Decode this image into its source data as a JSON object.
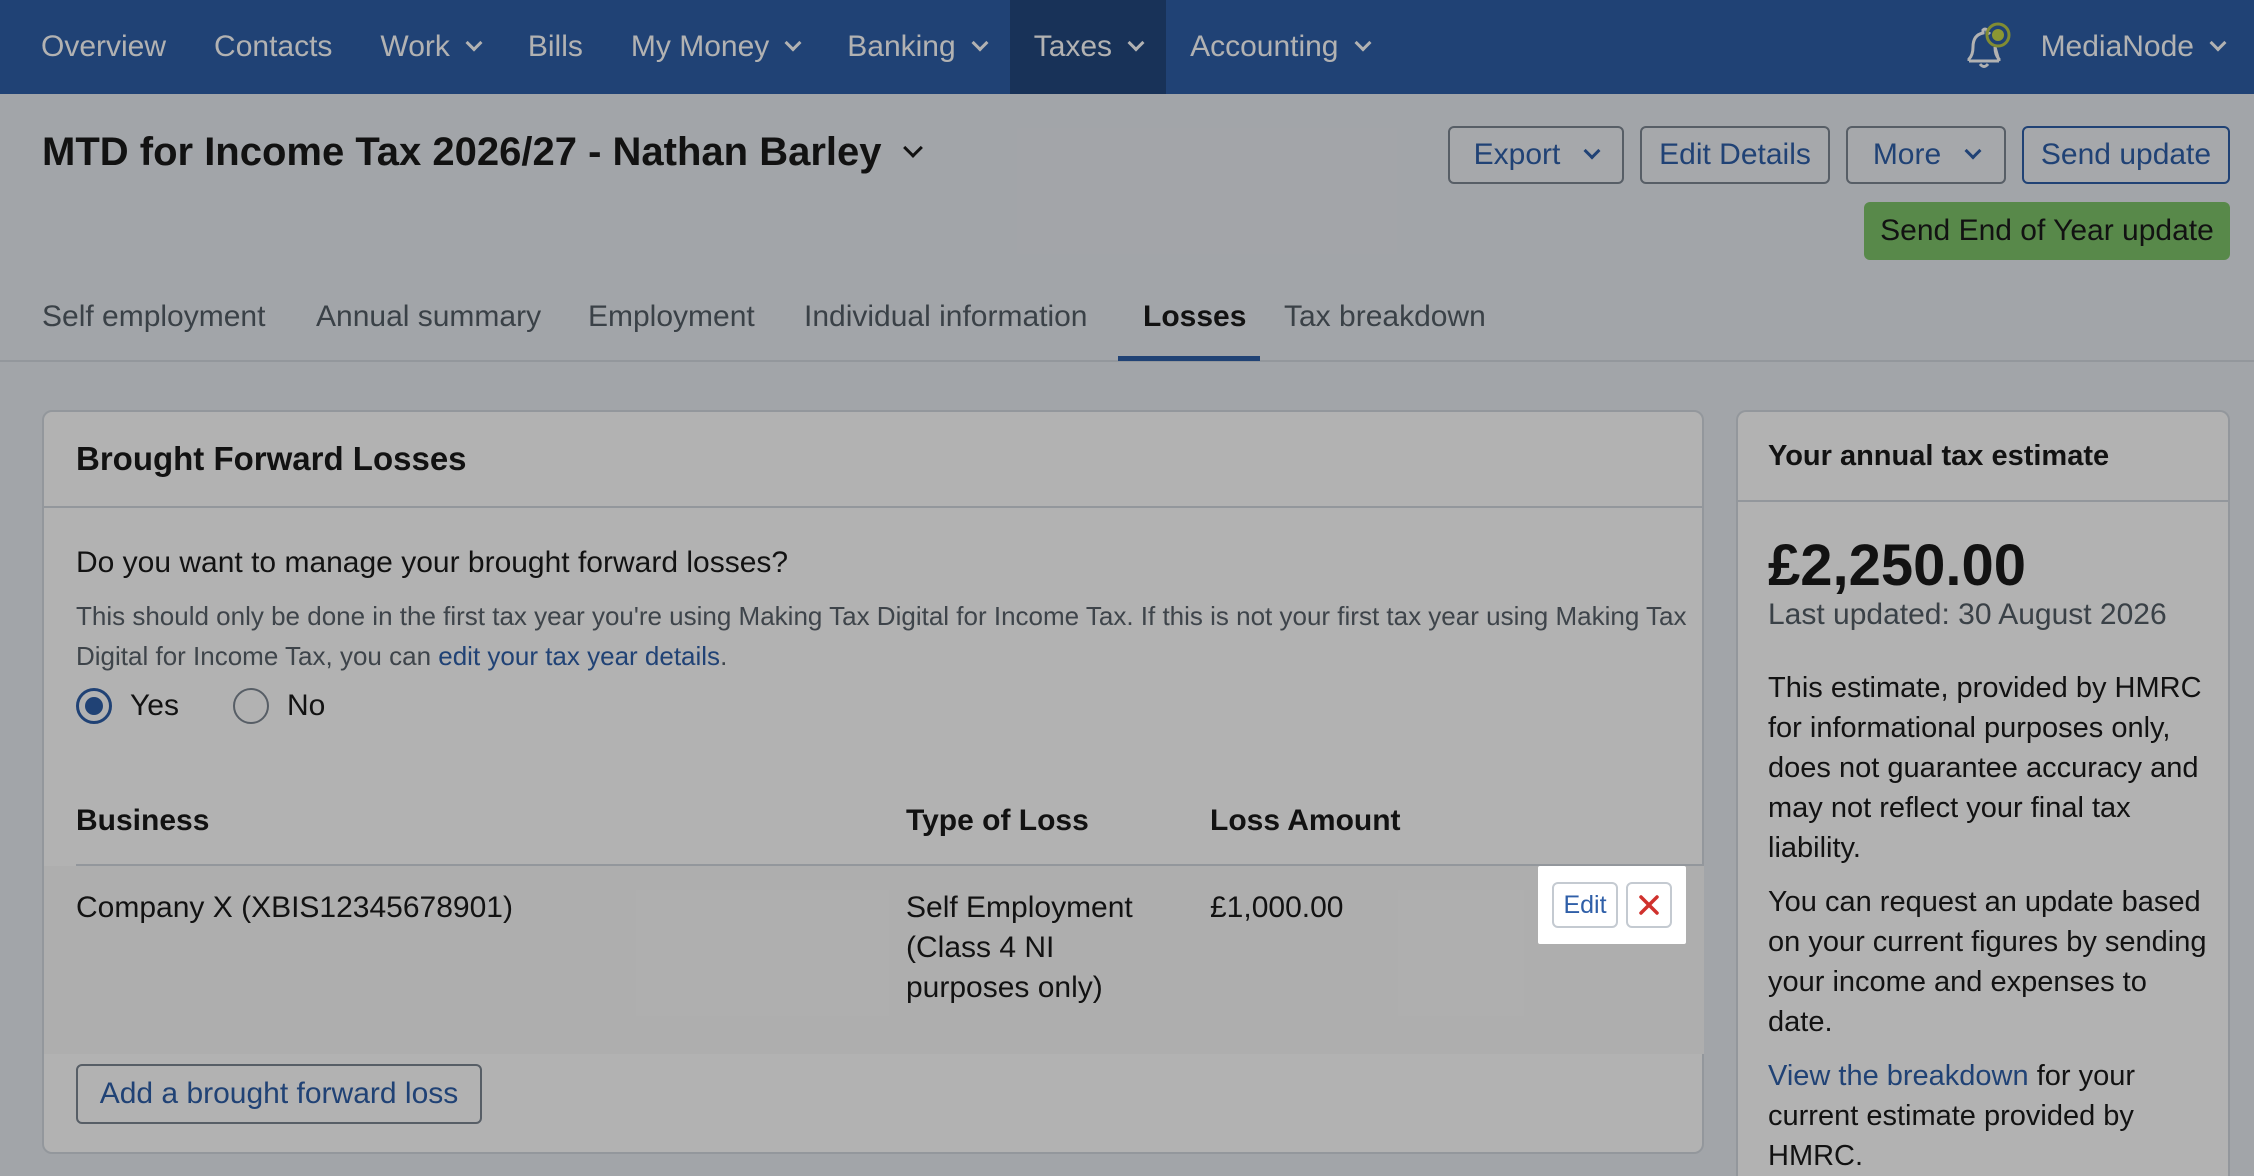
{
  "nav": {
    "items": [
      {
        "label": "Overview",
        "dropdown": false,
        "active": false
      },
      {
        "label": "Contacts",
        "dropdown": false,
        "active": false
      },
      {
        "label": "Work",
        "dropdown": true,
        "active": false
      },
      {
        "label": "Bills",
        "dropdown": false,
        "active": false
      },
      {
        "label": "My Money",
        "dropdown": true,
        "active": false
      },
      {
        "label": "Banking",
        "dropdown": true,
        "active": false
      },
      {
        "label": "Taxes",
        "dropdown": true,
        "active": true
      },
      {
        "label": "Accounting",
        "dropdown": true,
        "active": false
      }
    ],
    "account": "MediaNode",
    "bell_icon": "notification-bell-icon"
  },
  "header": {
    "title": "MTD for Income Tax 2026/27 - Nathan Barley",
    "buttons": {
      "export": "Export",
      "edit_details": "Edit Details",
      "more": "More",
      "send_update": "Send update",
      "send_eoy": "Send End of Year update"
    }
  },
  "tabs": [
    {
      "label": "Self employment",
      "active": false
    },
    {
      "label": "Annual summary",
      "active": false
    },
    {
      "label": "Employment",
      "active": false
    },
    {
      "label": "Individual information",
      "active": false
    },
    {
      "label": "Losses",
      "active": true
    },
    {
      "label": "Tax breakdown",
      "active": false
    }
  ],
  "losses": {
    "title": "Brought Forward Losses",
    "question": "Do you want to manage your brought forward losses?",
    "help_text": "This should only be done in the first tax year you're using Making Tax Digital for Income Tax. If this is not your first tax year using Making Tax Digital for Income Tax, you can ",
    "help_link": "edit your tax year details",
    "help_end": ".",
    "radio": {
      "yes": "Yes",
      "no": "No",
      "selected": "yes"
    },
    "columns": [
      "Business",
      "Type of Loss",
      "Loss Amount"
    ],
    "rows": [
      {
        "business": "Company X (XBIS12345678901)",
        "type_line1": "Self Employment",
        "type_line2": "(Class 4 NI",
        "type_line3": "purposes only)",
        "amount": "£1,000.00",
        "edit_label": "Edit"
      }
    ],
    "add_button": "Add a brought forward loss"
  },
  "estimate": {
    "title": "Your annual tax estimate",
    "amount": "£2,250.00",
    "updated": "Last updated: 30 August 2026",
    "para1": "This estimate, provided by HMRC for informational purposes only, does not guarantee accuracy and may not reflect your final tax liability.",
    "para2": "You can request an update based on your current figures by sending your income and expenses to date.",
    "para3_link": "View the breakdown",
    "para3_rest": " for your current estimate provided by HMRC."
  },
  "colors": {
    "brand": "#2f5fa8",
    "nav_active": "#23487f",
    "success": "#7fc56b",
    "danger": "#d0312d"
  }
}
